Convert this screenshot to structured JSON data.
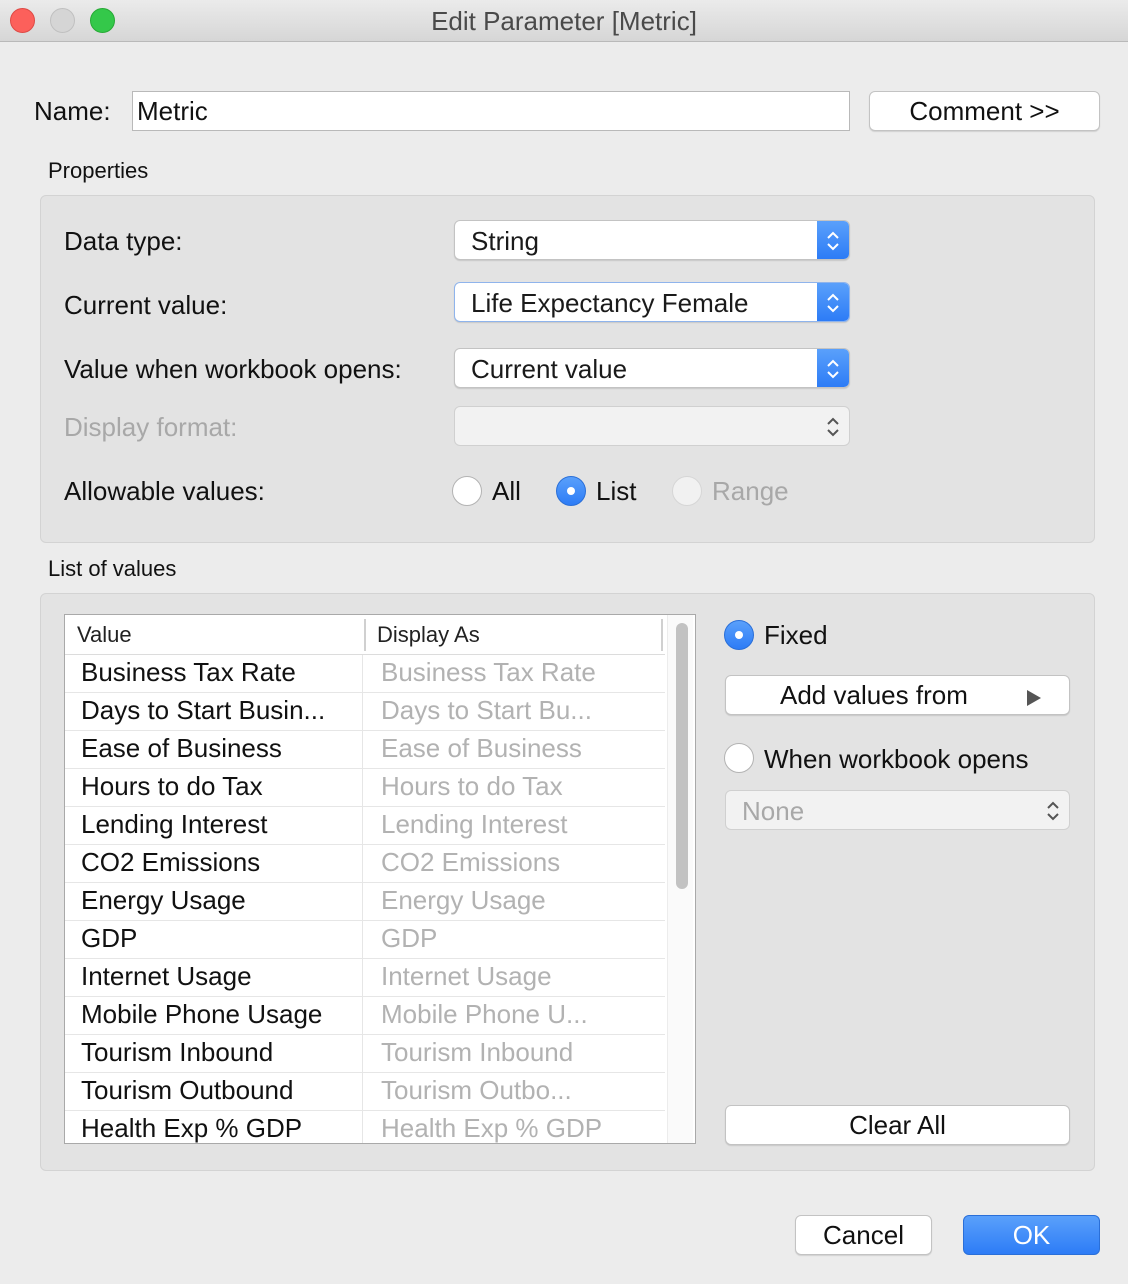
{
  "window": {
    "title": "Edit Parameter [Metric]"
  },
  "name_row": {
    "label": "Name:",
    "value": "Metric",
    "comment_button": "Comment >>"
  },
  "properties": {
    "section_label": "Properties",
    "data_type_label": "Data type:",
    "data_type_value": "String",
    "current_value_label": "Current value:",
    "current_value_value": "Life Expectancy Female",
    "workbook_opens_label": "Value when workbook opens:",
    "workbook_opens_value": "Current value",
    "display_format_label": "Display format:",
    "display_format_value": "",
    "allowable_label": "Allowable values:",
    "allowable_options": [
      {
        "label": "All",
        "selected": false,
        "enabled": true
      },
      {
        "label": "List",
        "selected": true,
        "enabled": true
      },
      {
        "label": "Range",
        "selected": false,
        "enabled": false
      }
    ]
  },
  "list_of_values": {
    "section_label": "List of values",
    "columns": [
      "Value",
      "Display As"
    ],
    "rows": [
      {
        "value": "Business Tax Rate",
        "display": "Business Tax Rate"
      },
      {
        "value": "Days to Start Busin...",
        "display": "Days to Start Bu..."
      },
      {
        "value": "Ease of Business",
        "display": "Ease of Business"
      },
      {
        "value": "Hours to do Tax",
        "display": "Hours to do Tax"
      },
      {
        "value": "Lending Interest",
        "display": "Lending Interest"
      },
      {
        "value": "CO2 Emissions",
        "display": "CO2 Emissions"
      },
      {
        "value": "Energy Usage",
        "display": "Energy Usage"
      },
      {
        "value": "GDP",
        "display": "GDP"
      },
      {
        "value": "Internet Usage",
        "display": "Internet Usage"
      },
      {
        "value": "Mobile Phone Usage",
        "display": "Mobile Phone U..."
      },
      {
        "value": "Tourism Inbound",
        "display": "Tourism Inbound"
      },
      {
        "value": "Tourism Outbound",
        "display": "Tourism Outbo..."
      },
      {
        "value": "Health Exp % GDP",
        "display": "Health Exp % GDP"
      }
    ],
    "fixed_label": "Fixed",
    "add_values_label": "Add values from",
    "workbook_opens_label": "When workbook opens",
    "workbook_opens_select": "None",
    "clear_all_label": "Clear All"
  },
  "footer": {
    "cancel_label": "Cancel",
    "ok_label": "OK"
  },
  "colors": {
    "accent": "#2d7cf6",
    "panel": "#e3e3e3",
    "background": "#ececec"
  }
}
